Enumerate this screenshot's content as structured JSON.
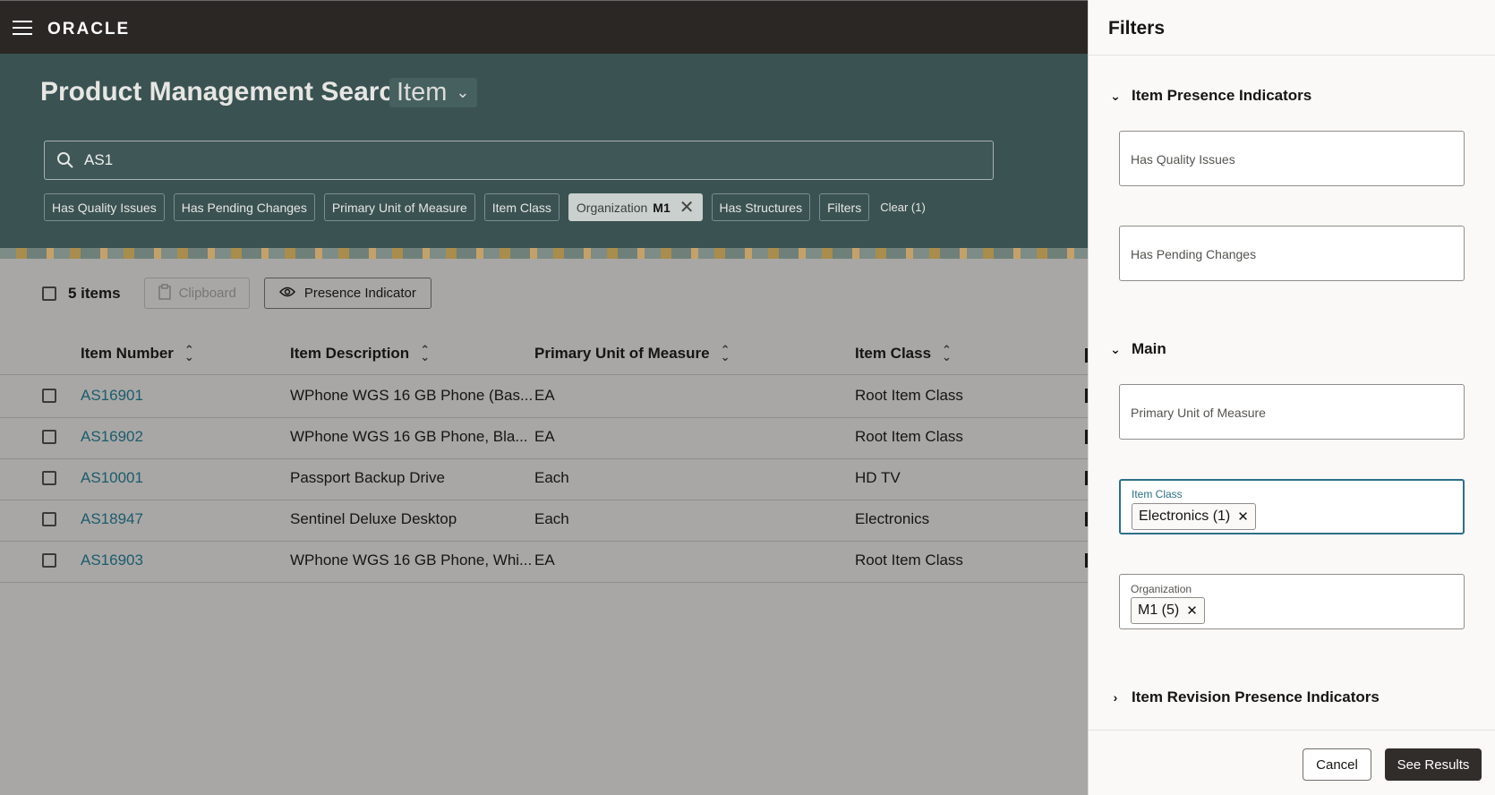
{
  "header": {
    "brand": "ORACLE"
  },
  "page": {
    "title": "Product Management Search",
    "object_type": "Item"
  },
  "search": {
    "value": "AS1"
  },
  "chips": [
    {
      "label": "Has Quality Issues"
    },
    {
      "label": "Has Pending Changes"
    },
    {
      "label": "Primary Unit of Measure"
    },
    {
      "label": "Item Class"
    },
    {
      "label": "Organization",
      "value": "M1"
    },
    {
      "label": "Has Structures"
    },
    {
      "label": "Filters"
    }
  ],
  "clear_label": "Clear (1)",
  "toolbar": {
    "items_count": "5 items",
    "clipboard_label": "Clipboard",
    "presence_label": "Presence Indicator"
  },
  "table": {
    "columns": [
      "Item Number",
      "Item Description",
      "Primary Unit of Measure",
      "Item Class"
    ],
    "rows": [
      [
        "AS16901",
        "WPhone WGS 16 GB Phone (Bas...",
        "EA",
        "Root Item Class"
      ],
      [
        "AS16902",
        "WPhone WGS 16 GB Phone, Bla...",
        "EA",
        "Root Item Class"
      ],
      [
        "AS10001",
        "Passport Backup Drive",
        "Each",
        "HD TV"
      ],
      [
        "AS18947",
        "Sentinel Deluxe Desktop",
        "Each",
        "Electronics"
      ],
      [
        "AS16903",
        "WPhone WGS 16 GB Phone, Whi...",
        "EA",
        "Root Item Class"
      ]
    ]
  },
  "filters": {
    "title": "Filters",
    "sections": {
      "presence": "Item Presence Indicators",
      "main": "Main",
      "revision": "Item Revision Presence Indicators"
    },
    "fields": {
      "quality": "Has Quality Issues",
      "pending": "Has Pending Changes",
      "uom": "Primary Unit of Measure",
      "item_class_label": "Item Class",
      "item_class_tag": "Electronics (1)",
      "org_label": "Organization",
      "org_tag": "M1 (5)"
    },
    "cancel_label": "Cancel",
    "see_results_label": "See Results"
  }
}
